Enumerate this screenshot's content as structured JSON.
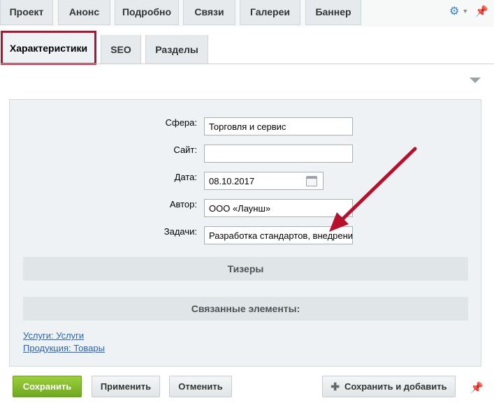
{
  "tabs_top": [
    "Проект",
    "Анонс",
    "Подробно",
    "Связи",
    "Галереи",
    "Баннер"
  ],
  "tabs_second": [
    "Характеристики",
    "SEO",
    "Разделы"
  ],
  "form": {
    "labels": {
      "sfera": "Сфера:",
      "site": "Сайт:",
      "date": "Дата:",
      "author": "Автор:",
      "tasks": "Задачи:"
    },
    "values": {
      "sfera": "Торговля и сервис",
      "site": "",
      "date": "08.10.2017",
      "author": "ООО «Лаунш»",
      "tasks": "Разработка стандартов, внедрени"
    }
  },
  "sections": {
    "teasers": "Тизеры",
    "related": "Связанные элементы:"
  },
  "links": [
    "Услуги: Услуги",
    "Продукция: Товары"
  ],
  "buttons": {
    "save": "Сохранить",
    "apply": "Применить",
    "cancel": "Отменить",
    "save_add": "Сохранить и добавить"
  },
  "icons": {
    "settings": "gear-icon",
    "pin": "pin-icon",
    "calendar": "calendar-icon",
    "expand": "triangle-down-icon",
    "plus": "plus-icon"
  },
  "colors": {
    "accent_border": "#b8102c",
    "arrow": "#b8102c",
    "primary_button": "#7fb72a",
    "link": "#2a64b7"
  }
}
